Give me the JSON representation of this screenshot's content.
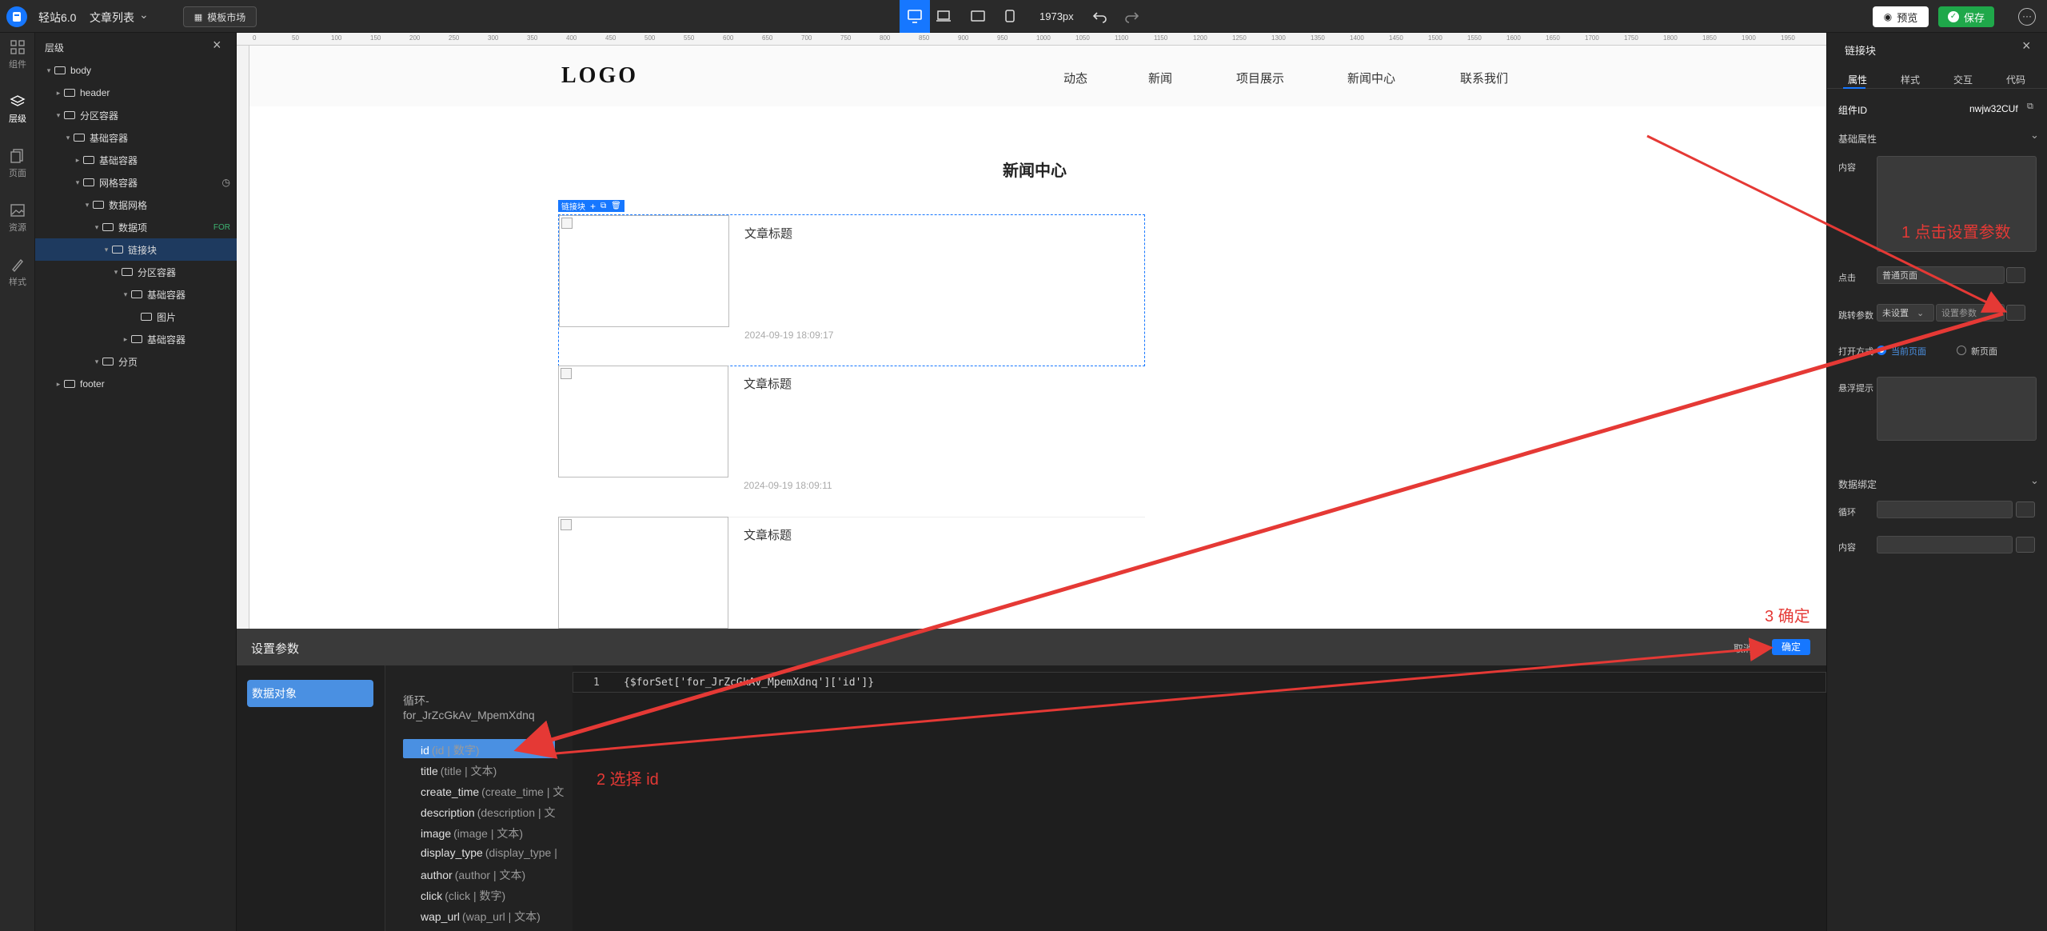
{
  "topbar": {
    "app_name": "轻站6.0",
    "page_select": "文章列表",
    "template_market": "模板市场",
    "width_readout": "1973px",
    "preview": "预览",
    "save": "保存"
  },
  "left_rail": {
    "items": [
      "组件",
      "层级",
      "页面",
      "资源",
      "样式"
    ]
  },
  "layers": {
    "title": "层级",
    "tree": [
      {
        "label": "body",
        "depth": 0
      },
      {
        "label": "header",
        "depth": 1
      },
      {
        "label": "分区容器",
        "depth": 1
      },
      {
        "label": "基础容器",
        "depth": 2
      },
      {
        "label": "基础容器",
        "depth": 3
      },
      {
        "label": "网格容器",
        "depth": 3
      },
      {
        "label": "数据网格",
        "depth": 4
      },
      {
        "label": "数据项",
        "depth": 5,
        "badge": "FOR"
      },
      {
        "label": "链接块",
        "depth": 6
      },
      {
        "label": "分区容器",
        "depth": 7
      },
      {
        "label": "基础容器",
        "depth": 8
      },
      {
        "label": "图片",
        "depth": 9
      },
      {
        "label": "基础容器",
        "depth": 8
      },
      {
        "label": "分页",
        "depth": 5
      },
      {
        "label": "footer",
        "depth": 1
      }
    ]
  },
  "canvas": {
    "logo": "LOGO",
    "nav": [
      "动态",
      "新闻",
      "项目展示",
      "新闻中心",
      "联系我们"
    ],
    "section_title": "新闻中心",
    "selection_label": "链接块",
    "articles": [
      {
        "title": "文章标题",
        "date": "2024-09-19 18:09:17"
      },
      {
        "title": "文章标题",
        "date": "2024-09-19 18:09:11"
      },
      {
        "title": "文章标题",
        "date": ""
      }
    ],
    "ruler_marks": [
      "0",
      "50",
      "100",
      "150",
      "200",
      "250",
      "300",
      "350",
      "400",
      "450",
      "500",
      "550",
      "600",
      "650",
      "700",
      "750",
      "800",
      "850",
      "900",
      "950",
      "1000",
      "1050",
      "1100",
      "1150",
      "1200",
      "1250",
      "1300",
      "1350",
      "1400",
      "1450",
      "1500",
      "1550",
      "1600",
      "1650",
      "1700",
      "1750",
      "1800",
      "1850",
      "1900",
      "1950"
    ]
  },
  "right_panel": {
    "title": "链接块",
    "tabs": [
      "属性",
      "样式",
      "交互",
      "代码"
    ],
    "component_id_label": "组件ID",
    "component_id": "nwjw32CUf",
    "basic_props": "基础属性",
    "content_label": "内容",
    "click_label": "点击",
    "click_value": "普通页面",
    "jump_param_label": "跳转参数",
    "jump_param_value": "未设置",
    "jump_param_btn": "设置参数",
    "open_mode_label": "打开方式",
    "open_current": "当前页面",
    "open_new": "新页面",
    "tooltip_label": "悬浮提示",
    "data_binding": "数据绑定",
    "loop_label": "循环",
    "content2_label": "内容"
  },
  "dialog": {
    "title": "设置参数",
    "cancel": "取消",
    "confirm": "确定",
    "sidebar_tab": "数据对象",
    "loop_name_line1": "循环-",
    "loop_name_line2": "for_JrZcGkAv_MpemXdnq",
    "fields": [
      {
        "name": "id",
        "meta": "(id | 数字)",
        "selected": true
      },
      {
        "name": "title",
        "meta": "(title | 文本)"
      },
      {
        "name": "create_time",
        "meta": "(create_time | 文"
      },
      {
        "name": "description",
        "meta": "(description | 文"
      },
      {
        "name": "image",
        "meta": "(image | 文本)"
      },
      {
        "name": "display_type",
        "meta": "(display_type |"
      },
      {
        "name": "author",
        "meta": "(author | 文本)"
      },
      {
        "name": "click",
        "meta": "(click | 数字)"
      },
      {
        "name": "wap_url",
        "meta": "(wap_url | 文本)"
      }
    ],
    "editor_line_no": "1",
    "editor_code": "{$forSet['for_JrZcGkAv_MpemXdnq']['id']}"
  },
  "annotations": {
    "step1": "1 点击设置参数",
    "step2": "2 选择 id",
    "step3": "3 确定"
  },
  "colors": {
    "accent": "#1677ff",
    "save_green": "#1fa84a",
    "annotation_red": "#e53935"
  }
}
